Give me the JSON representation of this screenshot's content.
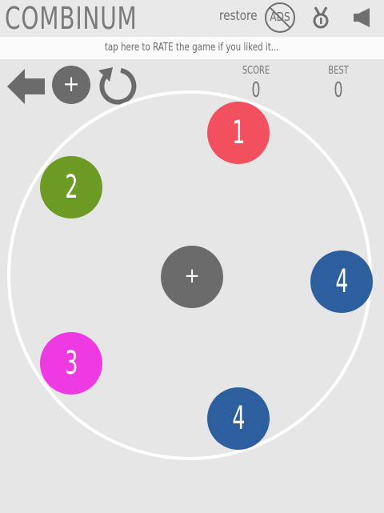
{
  "header": {
    "title": "COMBINUM",
    "restore_label": "restore",
    "noads_label": "ADS"
  },
  "rate_banner": {
    "text": "tap here to RATE the game if you liked it..."
  },
  "toolbar": {
    "add_label": "+"
  },
  "scores": {
    "score_label": "SCORE",
    "score_value": "0",
    "best_label": "BEST",
    "best_value": "0"
  },
  "board": {
    "center_label": "+",
    "balls": [
      {
        "value": "1",
        "color": "#f2505f"
      },
      {
        "value": "2",
        "color": "#6c9b25"
      },
      {
        "value": "4",
        "color": "#2d5e9e"
      },
      {
        "value": "3",
        "color": "#ee3ae3"
      },
      {
        "value": "4",
        "color": "#2d5e9e"
      }
    ]
  },
  "colors": {
    "background": "#e6e6e6",
    "icon_gray": "#6b6b6b",
    "ring": "#ffffff"
  }
}
